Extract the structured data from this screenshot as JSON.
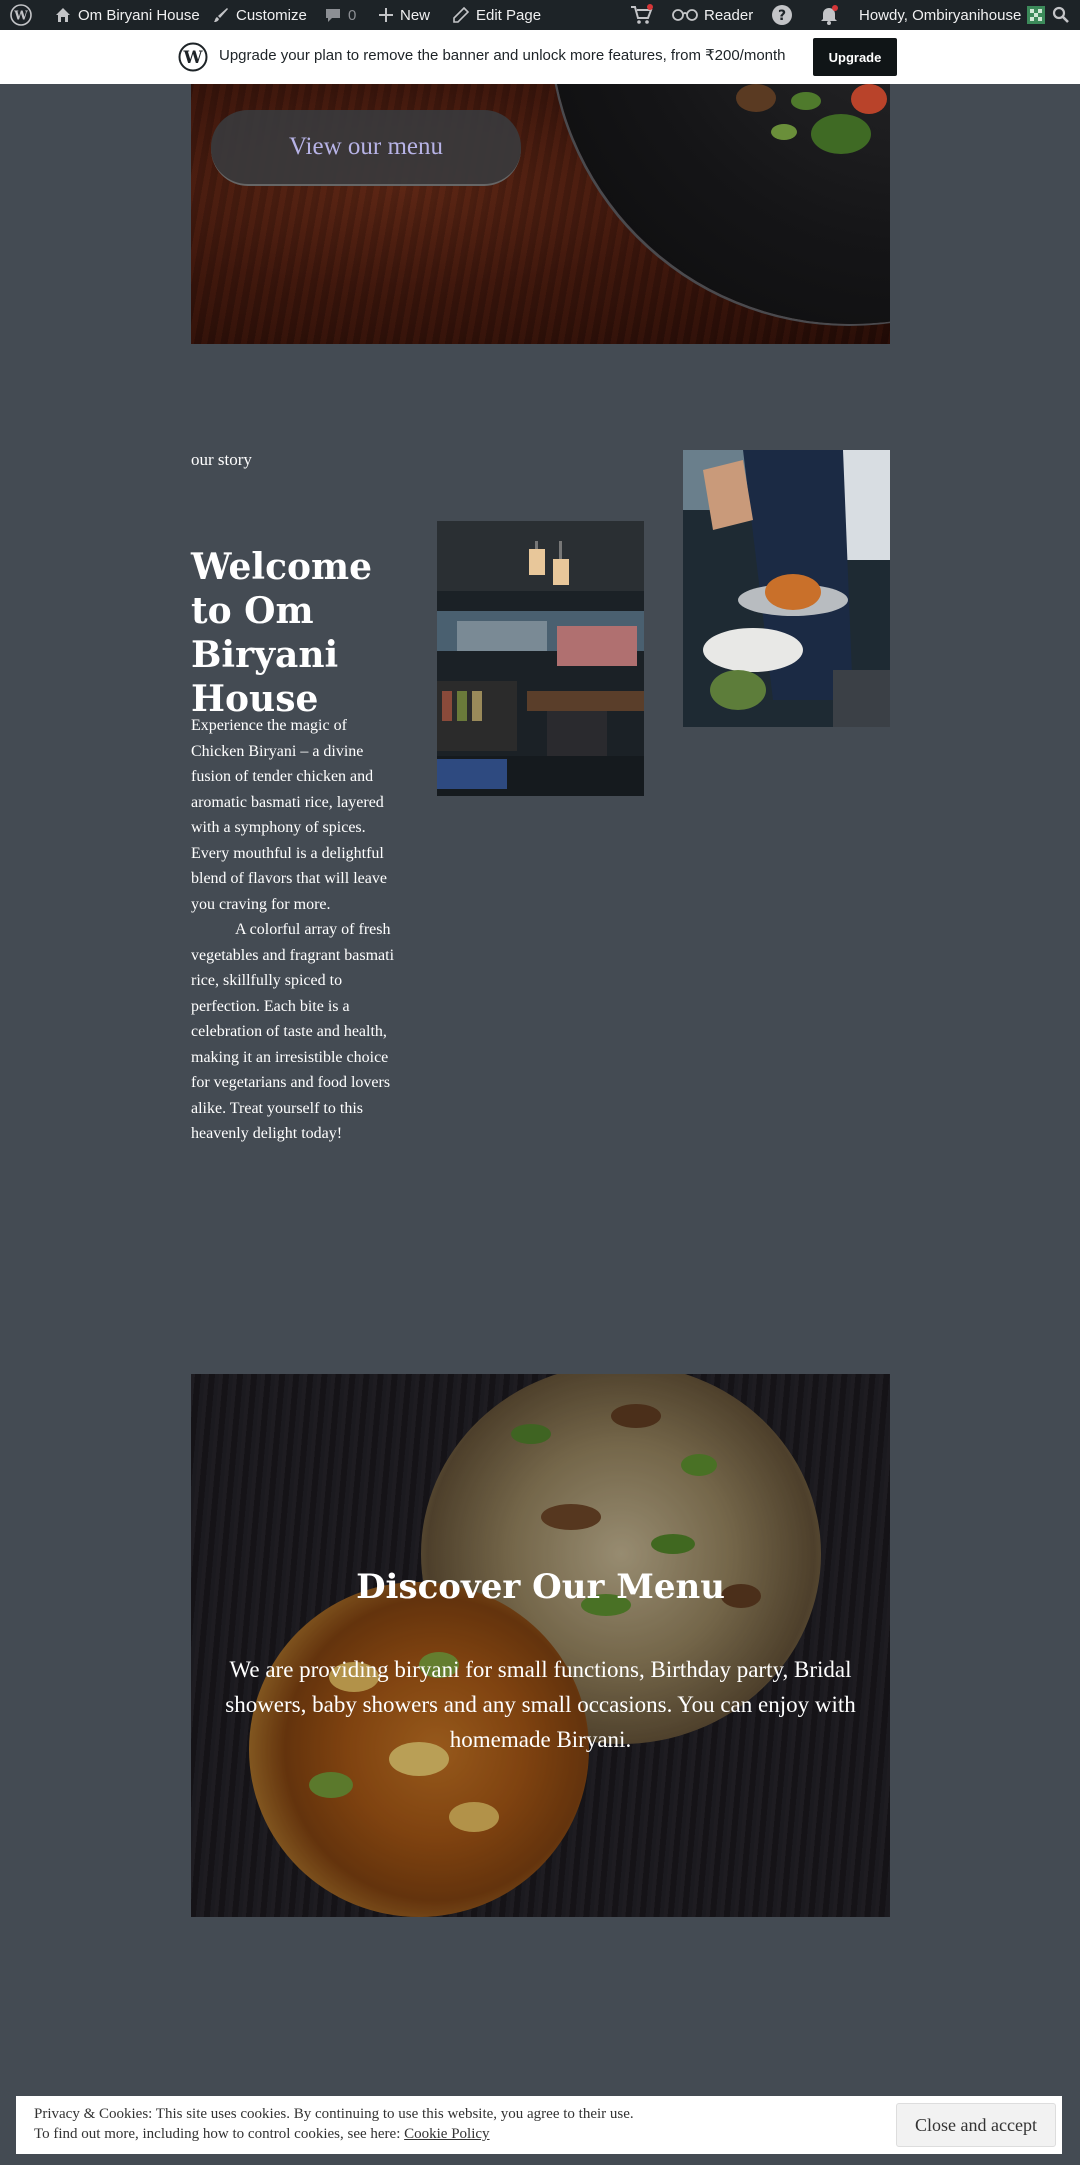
{
  "admin_bar": {
    "site_name": "Om Biryani House",
    "customize": "Customize",
    "comments_count": "0",
    "new": "New",
    "edit_page": "Edit Page",
    "reader": "Reader",
    "howdy": "Howdy, Ombiryanihouse"
  },
  "upgrade_banner": {
    "text": "Upgrade your plan to remove the banner and unlock more features, from ₹200/month",
    "button": "Upgrade"
  },
  "hero": {
    "button": "View our menu"
  },
  "story": {
    "label": "our story",
    "title": "Welcome to Om Biryani House",
    "paragraph1": "Experience the magic of Chicken Biryani – a divine fusion of tender chicken and aromatic basmati rice, layered with a symphony of spices. Every mouthful is a delightful blend of flavors that will leave you craving for more.",
    "paragraph2": "A colorful array of fresh vegetables and fragrant basmati rice, skillfully spiced to perfection. Each bite is a celebration of taste and health, making it an irresistible choice for vegetarians and food lovers alike. Treat yourself to this heavenly delight today!"
  },
  "discover": {
    "title": "Discover Our Menu",
    "text": "We are providing biryani for small functions, Birthday party, Bridal showers, baby showers and any small occasions. You can enjoy with homemade Biryani."
  },
  "cookie": {
    "line1": "Privacy & Cookies: This site uses cookies. By continuing to use this website, you agree to their use.",
    "line2": "To find out more, including how to control cookies, see here:",
    "link": "Cookie Policy",
    "button": "Close and accept"
  },
  "colors": {
    "page_bg": "#444b53",
    "admin_bar": "#1d2327",
    "menu_button_text": "#b7b3e6",
    "notification_dot": "#d63638"
  }
}
